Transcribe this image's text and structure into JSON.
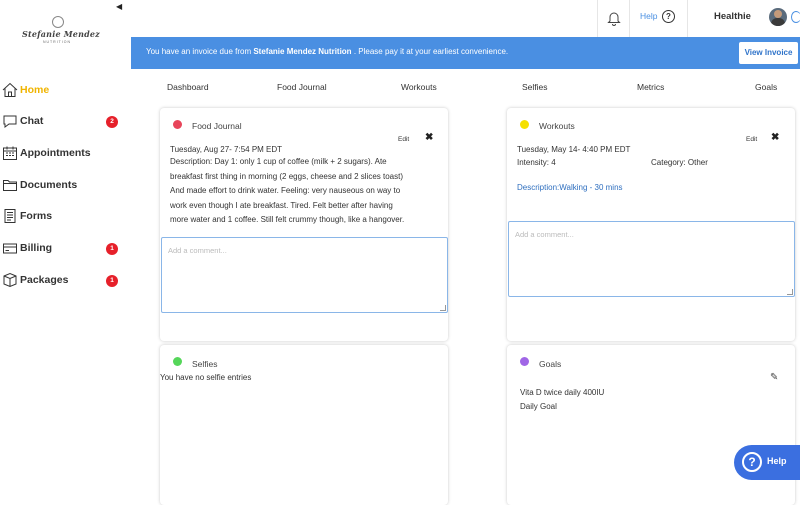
{
  "brand": {
    "logo_name": "Stefanie Mendez",
    "logo_sub": "NUTRITION",
    "app_name": "Healthie"
  },
  "topbar": {
    "help_label": "Help",
    "help_icon": "?"
  },
  "sidebar": {
    "items": [
      {
        "label": "Home",
        "icon": "home-icon",
        "active": true,
        "badge": ""
      },
      {
        "label": "Chat",
        "icon": "chat-icon",
        "badge": "2"
      },
      {
        "label": "Appointments",
        "icon": "calendar-icon",
        "badge": ""
      },
      {
        "label": "Documents",
        "icon": "folder-icon",
        "badge": ""
      },
      {
        "label": "Forms",
        "icon": "forms-icon",
        "badge": ""
      },
      {
        "label": "Billing",
        "icon": "billing-icon",
        "badge": "1"
      },
      {
        "label": "Packages",
        "icon": "packages-icon",
        "badge": "1"
      }
    ]
  },
  "banner": {
    "text_prefix": "You have an invoice due from",
    "provider": "Stefanie Mendez Nutrition",
    "text_suffix": ". Please pay it at your earliest convenience.",
    "button_label": "View Invoice"
  },
  "tabs": [
    "Dashboard",
    "Food Journal",
    "Workouts",
    "Selfies",
    "Metrics",
    "Goals"
  ],
  "food_journal": {
    "title": "Food Journal",
    "dot_color": "#e8455a",
    "edit_label": "Edit",
    "close_label": "✖",
    "date": "Tuesday, Aug 27- 7:54 PM EDT",
    "description_lines": [
      "Description: Day 1: only 1 cup of coffee (milk + 2 sugars). Ate",
      "breakfast first thing in morning (2 eggs, cheese and 2 slices toast)",
      "And made effort to drink water. Feeling: very nauseous on way to",
      "work even though I ate breakfast. Tired. Felt better after having",
      "more water and 1 coffee. Still felt crummy though, like a hangover."
    ],
    "comment_placeholder": "Add a comment..."
  },
  "workouts": {
    "title": "Workouts",
    "dot_color": "#f5e000",
    "edit_label": "Edit",
    "close_label": "✖",
    "date": "Tuesday, May 14- 4:40 PM EDT",
    "intensity": "Intensity: 4",
    "category": "Category: Other",
    "description": "Description:Walking - 30 mins",
    "comment_placeholder": "Add a comment..."
  },
  "selfies": {
    "title": "Selfies",
    "dot_color": "#55d65a",
    "empty_text": "You have no selfie entries"
  },
  "goals": {
    "title": "Goals",
    "dot_color": "#a066e6",
    "edit_icon": "✎",
    "goal_name": "Vita D twice daily 400IU",
    "goal_type": "Daily Goal"
  },
  "help_fab": {
    "icon": "?",
    "label": "Help"
  }
}
